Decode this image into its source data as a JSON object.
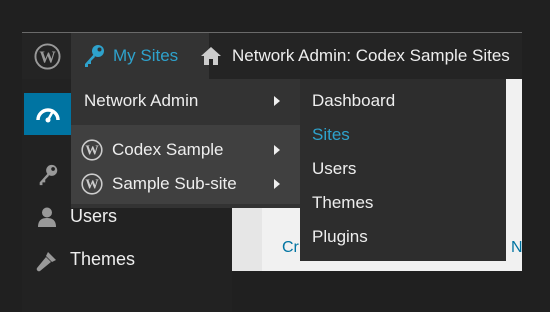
{
  "adminbar": {
    "wp_logo": "wordpress-logo-icon",
    "my_sites": {
      "label": "My Sites",
      "icon": "key-icon",
      "color": "#2ea2cc"
    },
    "network": {
      "label": "Network Admin: Codex Sample Sites",
      "icon": "home-icon"
    }
  },
  "sidebar": {
    "items": [
      {
        "icon": "dashboard-icon",
        "label": ""
      },
      {
        "icon": "key-icon",
        "label": ""
      },
      {
        "icon": "users-icon",
        "label": "Users"
      },
      {
        "icon": "themes-icon",
        "label": "Themes"
      }
    ],
    "active_color": "#0074a2"
  },
  "content": {
    "link_left": "Cr",
    "link_right": "N"
  },
  "my_sites_menu": {
    "network_admin": "Network Admin",
    "sites": [
      {
        "label": "Codex Sample",
        "icon": "wordpress-logo-icon"
      },
      {
        "label": "Sample Sub-site",
        "icon": "wordpress-logo-icon"
      }
    ]
  },
  "network_submenu": {
    "items": [
      "Dashboard",
      "Sites",
      "Users",
      "Themes",
      "Plugins"
    ],
    "active": "Sites"
  }
}
